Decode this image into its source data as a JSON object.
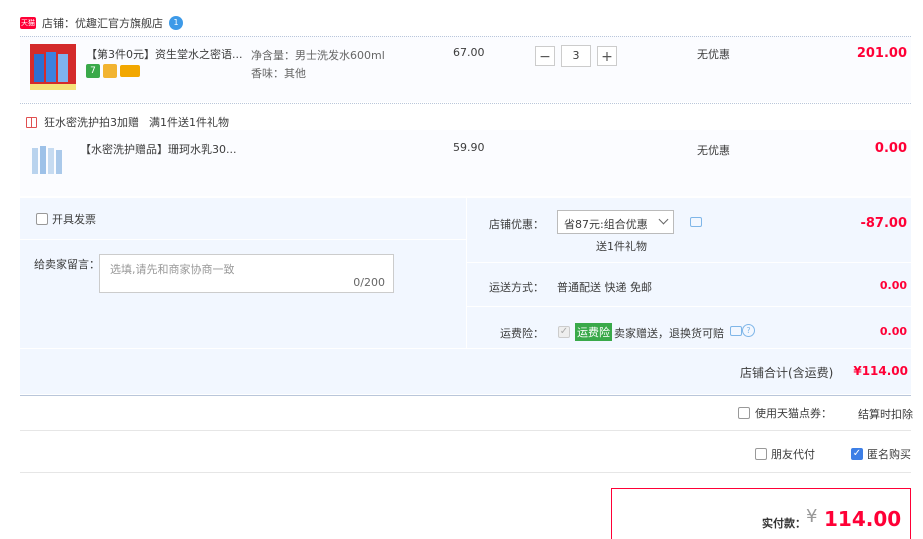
{
  "shop": {
    "label": "店铺：优趣汇官方旗舰店",
    "tmall_badge": "天猫",
    "chat_badge": "1"
  },
  "item1": {
    "title": "【第3件0元】资生堂水之密语...",
    "spec1": "净含量：男士洗发水600ml",
    "spec2": "香味：其他",
    "price": "67.00",
    "qty": "3",
    "qty_minus": "−",
    "qty_plus": "+",
    "discount": "无优惠",
    "subtotal": "201.00",
    "tag_icons": [
      "seven-day-return-icon",
      "guarantee-icon",
      "card-icon"
    ],
    "tag_seven": "7"
  },
  "promo": {
    "text": "狂水密洗护拍3加赠",
    "rule": "满1件送1件礼物"
  },
  "item2": {
    "title": "【水密洗护赠品】珊珂水乳30...",
    "price": "59.90",
    "discount": "无优惠",
    "subtotal": "0.00"
  },
  "invoice": {
    "label": "开具发票"
  },
  "message": {
    "label": "给卖家留言：",
    "placeholder": "选填,请先和商家协商一致",
    "counter": "0/200"
  },
  "shop_discount": {
    "label": "店铺优惠：",
    "select_value": "省87元:组合优惠",
    "gift": "送1件礼物",
    "amount": "-87.00"
  },
  "shipping": {
    "label": "运送方式：",
    "value": "普通配送 快递 免邮",
    "amount": "0.00"
  },
  "insurance": {
    "label": "运费险：",
    "badge": "运费险",
    "desc": "卖家赠送，退换货可赔",
    "amount": "0.00"
  },
  "total": {
    "label": "店铺合计(含运费)",
    "amount": "¥114.00"
  },
  "points": {
    "label": "使用天猫点券：",
    "note": "结算时扣除"
  },
  "options": {
    "friend_pay": "朋友代付",
    "anonymous": "匿名购买"
  },
  "pay": {
    "label": "实付款：",
    "currency": "¥",
    "amount": "114.00"
  },
  "colors": {
    "accent_red": "#ff0036",
    "panel_blue": "#f2f7ff",
    "tmall_red": "#ff0036"
  }
}
